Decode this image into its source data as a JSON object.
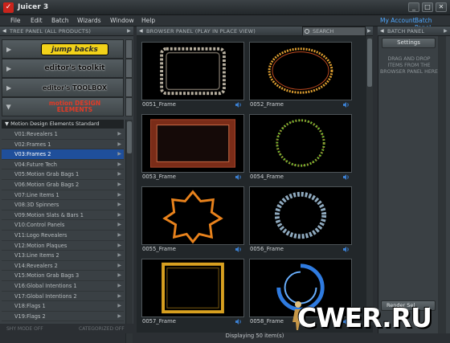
{
  "window": {
    "title": "Juicer 3"
  },
  "menu": {
    "items": [
      "File",
      "Edit",
      "Batch",
      "Wizards",
      "Window",
      "Help"
    ],
    "account_link": "My Account",
    "batch_link": "Batch Panel"
  },
  "tree_panel": {
    "header": "TREE PANEL (ALL PRODUCTS)",
    "brands": [
      "jump backs",
      "editor's toolkit",
      "editor's TOOLBOX",
      "motion DESIGN ELEMENTS"
    ],
    "category": "Motion Design Elements Standard",
    "items": [
      "V01:Revealers 1",
      "V02:Frames 1",
      "V03:Frames 2",
      "V04:Future Tech",
      "V05:Motion Grab Bags 1",
      "V06:Motion Grab Bags 2",
      "V07:Line Items 1",
      "V08:3D Spinners",
      "V09:Motion Slats & Bars 1",
      "V10:Control Panels",
      "V11:Logo Revealers",
      "V12:Motion Plaques",
      "V13:Line Items 2",
      "V14:Revealers 2",
      "V15:Motion Grab Bags 3",
      "V16:Global Intentions 1",
      "V17:Global Intentions 2",
      "V18:Flags 1",
      "V19:Flags 2"
    ],
    "selected_index": 2,
    "footer_left": "SHY MODE OFF",
    "footer_right": "CATEGORIZED OFF"
  },
  "browser_panel": {
    "header": "BROWSER PANEL (PLAY IN PLACE VIEW)",
    "search_placeholder": "SEARCH",
    "thumbnails": [
      "0051_Frame",
      "0052_Frame",
      "0053_Frame",
      "0054_Frame",
      "0055_Frame",
      "0056_Frame",
      "0057_Frame",
      "0058_Frame"
    ],
    "status": "Displaying 50 item(s)"
  },
  "batch_panel": {
    "header": "BATCH PANEL",
    "settings_label": "Settings",
    "drop_message": "DRAG AND DROP ITEMS FROM THE BROWSER PANEL HERE",
    "render_label": "Render Sel"
  },
  "watermark": {
    "text": "CWER.RU"
  }
}
